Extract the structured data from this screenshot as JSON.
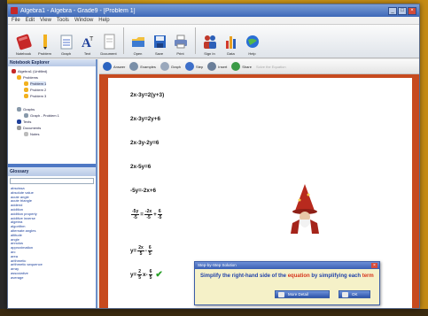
{
  "window": {
    "title": "Algebra1 - Algebra - Grade9 - [Problem 1]"
  },
  "menubar": {
    "items": [
      "File",
      "Edit",
      "View",
      "Tools",
      "Window",
      "Help"
    ]
  },
  "toolbar": {
    "buttons": [
      {
        "label": "Notebook",
        "icon": "notebook-icon"
      },
      {
        "label": "Problem",
        "icon": "problem-icon"
      },
      {
        "label": "Graph",
        "icon": "graph-icon"
      },
      {
        "label": "Text",
        "icon": "text-icon"
      },
      {
        "label": "Document",
        "icon": "document-icon"
      },
      {
        "label": "Open",
        "icon": "open-folder-icon"
      },
      {
        "label": "Save",
        "icon": "save-icon"
      },
      {
        "label": "Print",
        "icon": "printer-icon"
      },
      {
        "label": "Sign In",
        "icon": "users-icon"
      },
      {
        "label": "Data",
        "icon": "bar-chart-icon"
      },
      {
        "label": "Help",
        "icon": "globe-help-icon"
      }
    ]
  },
  "explorer": {
    "title": "Notebook Explorer",
    "nodes": [
      {
        "label": "Algebra1 (Untitled)",
        "level": 0
      },
      {
        "label": "Problems",
        "level": 1
      },
      {
        "label": "Problem 1",
        "level": 2
      },
      {
        "label": "Problem 2",
        "level": 2
      },
      {
        "label": "Problem 3",
        "level": 2
      },
      {
        "label": "Graphs",
        "level": 1
      },
      {
        "label": "Graph - Problem 1",
        "level": 2
      },
      {
        "label": "Texts",
        "level": 1
      },
      {
        "label": "Documents",
        "level": 1
      },
      {
        "label": "Notes",
        "level": 2
      }
    ]
  },
  "glossary": {
    "title": "Glossary",
    "terms": [
      "abscissa",
      "absolute value",
      "acute angle",
      "acute triangle",
      "addend",
      "addition",
      "addition property",
      "additive inverse",
      "algebra",
      "algorithm",
      "alternate angles",
      "altitude",
      "angle",
      "annulus",
      "approximation",
      "arc",
      "area",
      "arithmetic",
      "arithmetic sequence",
      "array",
      "associative",
      "average"
    ]
  },
  "subtoolbar": {
    "buttons": [
      {
        "label": "Answer",
        "disabled": false
      },
      {
        "label": "Examples",
        "disabled": false
      },
      {
        "label": "Graph",
        "disabled": false
      },
      {
        "label": "Step",
        "disabled": false
      },
      {
        "label": "Insert",
        "disabled": false
      },
      {
        "label": "Share",
        "disabled": false
      },
      {
        "label": "Solve the Equation",
        "disabled": true
      }
    ]
  },
  "steps": {
    "s1": "2x-3y=2(y+3)",
    "s2": "2x-3y=2y+6",
    "s3": "2x-3y-2y=6",
    "s4": "2x-5y=6",
    "s5": "-5y=-2x+6",
    "s6": {
      "a_num": "-5y",
      "a_den": "-5",
      "eq": "=",
      "b_num": "-2x",
      "b_den": "-5",
      "plus": "+",
      "c_num": "6",
      "c_den": "-5"
    },
    "s7": {
      "left": "y=",
      "a_num": "2x",
      "a_den": "5",
      "minus": "-",
      "b_num": "6",
      "b_den": "5"
    },
    "s8": {
      "left": "y=",
      "a_num": "2",
      "a_den": "5",
      "mid": "x-",
      "b_num": "6",
      "b_den": "5"
    }
  },
  "dialog": {
    "title": "Step-by-Step Solution",
    "message_a": "Simplify the right-hand side of the",
    "message_hl1": "equation",
    "message_b": "by simplifying each",
    "message_hl2": "term",
    "more_label": "More Detail",
    "ok_label": "OK"
  },
  "colors": {
    "accent": "#c74a1e",
    "brand": "#3e68b8",
    "check": "#2aa02a"
  }
}
